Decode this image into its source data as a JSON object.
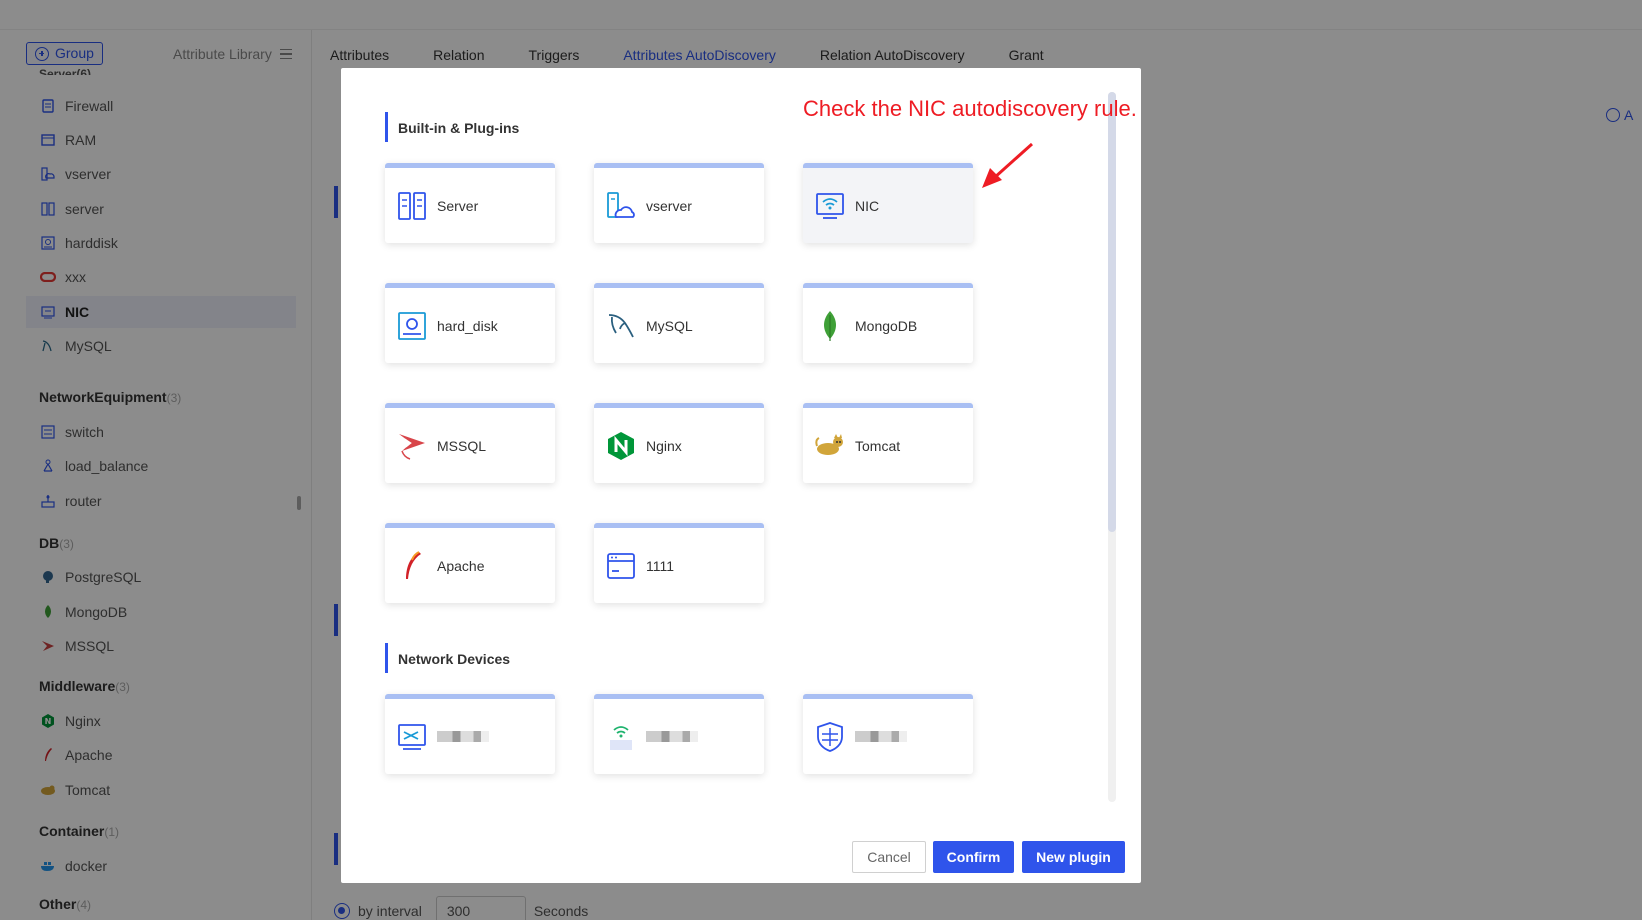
{
  "sidebar": {
    "group_button": "Group",
    "library_label": "Attribute Library",
    "partial_top_label": "Server(6)",
    "items_server": [
      {
        "label": "Firewall",
        "icon": "firewall-icon"
      },
      {
        "label": "RAM",
        "icon": "ram-icon"
      },
      {
        "label": "vserver",
        "icon": "vserver-icon"
      },
      {
        "label": "server",
        "icon": "server-icon"
      },
      {
        "label": "harddisk",
        "icon": "harddisk-icon"
      },
      {
        "label": "xxx",
        "icon": "oracle-icon"
      },
      {
        "label": "NIC",
        "icon": "nic-icon"
      },
      {
        "label": "MySQL",
        "icon": "mysql-icon"
      }
    ],
    "categories": [
      {
        "name": "NetworkEquipment",
        "count": "(3)",
        "items": [
          "switch",
          "load_balance",
          "router"
        ]
      },
      {
        "name": "DB",
        "count": "(3)",
        "items": [
          "PostgreSQL",
          "MongoDB",
          "MSSQL"
        ]
      },
      {
        "name": "Middleware",
        "count": "(3)",
        "items": [
          "Nginx",
          "Apache",
          "Tomcat"
        ]
      },
      {
        "name": "Container",
        "count": "(1)",
        "items": [
          "docker"
        ]
      },
      {
        "name": "Other",
        "count": "(4)",
        "items": []
      }
    ]
  },
  "tabs": [
    "Attributes",
    "Relation",
    "Triggers",
    "Attributes AutoDiscovery",
    "Relation AutoDiscovery",
    "Grant"
  ],
  "active_tab": "Attributes AutoDiscovery",
  "right_add_label": "A",
  "background_form": {
    "radio_label": "by interval",
    "interval_value": "300",
    "unit": "Seconds"
  },
  "modal": {
    "section1_title": "Built-in & Plug-ins",
    "section2_title": "Network Devices",
    "cards": [
      {
        "label": "Server",
        "icon": "server-rack-icon"
      },
      {
        "label": "vserver",
        "icon": "cloud-server-icon"
      },
      {
        "label": "NIC",
        "icon": "nic-wifi-icon"
      },
      {
        "label": "hard_disk",
        "icon": "harddisk-icon"
      },
      {
        "label": "MySQL",
        "icon": "mysql-dolphin-icon"
      },
      {
        "label": "MongoDB",
        "icon": "mongodb-leaf-icon"
      },
      {
        "label": "MSSQL",
        "icon": "mssql-icon"
      },
      {
        "label": "Nginx",
        "icon": "nginx-icon"
      },
      {
        "label": "Tomcat",
        "icon": "tomcat-icon"
      },
      {
        "label": "Apache",
        "icon": "apache-feather-icon"
      },
      {
        "label": "1111",
        "icon": "window-icon"
      }
    ],
    "network_cards": [
      {
        "icon": "switch-icon"
      },
      {
        "icon": "wifi-router-icon"
      },
      {
        "icon": "firewall-shield-icon"
      }
    ],
    "annotation": "Check the NIC autodiscovery rule.",
    "buttons": {
      "cancel": "Cancel",
      "confirm": "Confirm",
      "new_plugin": "New plugin"
    }
  },
  "colors": {
    "primary": "#2f54eb",
    "annotation": "#ee1c24",
    "card_top": "#a9bff3"
  }
}
